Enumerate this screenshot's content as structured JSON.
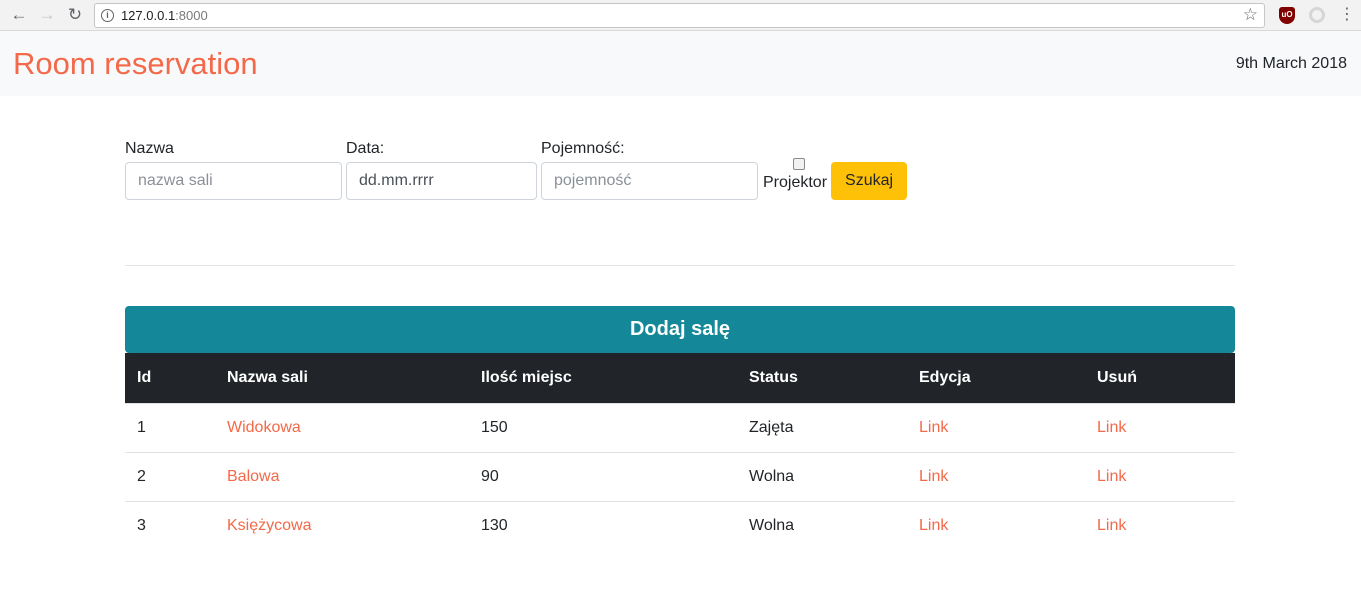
{
  "browser": {
    "url_host": "127.0.0.1",
    "url_port": ":8000"
  },
  "navbar": {
    "brand": "Room reservation",
    "date": "9th March 2018"
  },
  "search": {
    "name_label": "Nazwa",
    "name_placeholder": "nazwa sali",
    "date_label": "Data:",
    "date_placeholder": "dd.mm.rrrr",
    "capacity_label": "Pojemność:",
    "capacity_placeholder": "pojemność",
    "projector_label": "Projektor",
    "projector_checked": false,
    "submit_label": "Szukaj"
  },
  "rooms": {
    "add_label": "Dodaj salę",
    "headers": [
      "Id",
      "Nazwa sali",
      "Ilość miejsc",
      "Status",
      "Edycja",
      "Usuń"
    ],
    "rows": [
      {
        "id": "1",
        "name": "Widokowa",
        "seats": "150",
        "status": "Zajęta",
        "edit": "Link",
        "delete": "Link"
      },
      {
        "id": "2",
        "name": "Balowa",
        "seats": "90",
        "status": "Wolna",
        "edit": "Link",
        "delete": "Link"
      },
      {
        "id": "3",
        "name": "Księżycowa",
        "seats": "130",
        "status": "Wolna",
        "edit": "Link",
        "delete": "Link"
      }
    ]
  },
  "colors": {
    "brand": "#f36949",
    "primary_teal": "#148898",
    "warning": "#ffc107",
    "dark": "#212529"
  }
}
